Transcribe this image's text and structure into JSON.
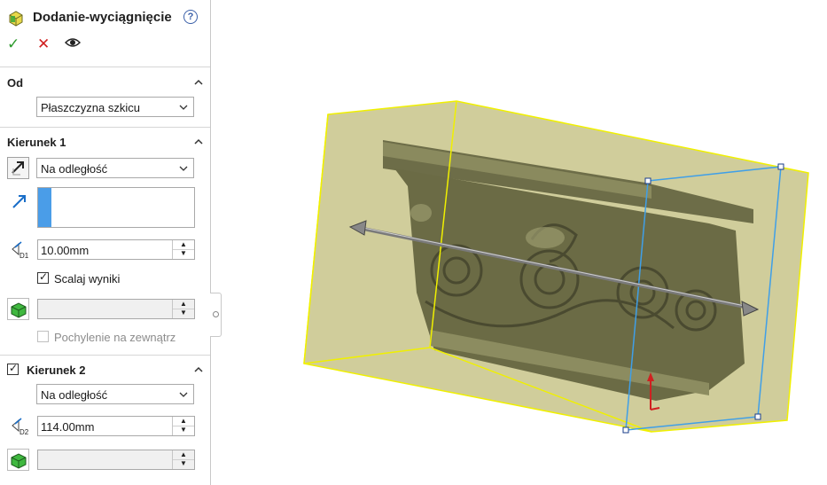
{
  "header": {
    "title": "Dodanie-wyciągnięcie",
    "help_icon": "?"
  },
  "actions": {
    "ok": "✓",
    "cancel": "✕",
    "preview": "👁"
  },
  "from": {
    "title": "Od",
    "value": "Płaszczyzna szkicu"
  },
  "direction1": {
    "title": "Kierunek 1",
    "end_condition": "Na odległość",
    "depth": "10.00mm",
    "merge_checked": true,
    "merge_label": "Scalaj wyniki",
    "draft_label": "Pochylenie na zewnątrz",
    "draft_checked": false,
    "draft_value": ""
  },
  "direction2": {
    "title": "Kierunek 2",
    "enabled": true,
    "end_condition": "Na odległość",
    "depth": "114.00mm",
    "draft_value": ""
  },
  "colors": {
    "accent": "#4a9de8",
    "model": "#6b6b45",
    "bbox_yellow": "#f0f000",
    "preview_blue": "#3f9fe8"
  }
}
